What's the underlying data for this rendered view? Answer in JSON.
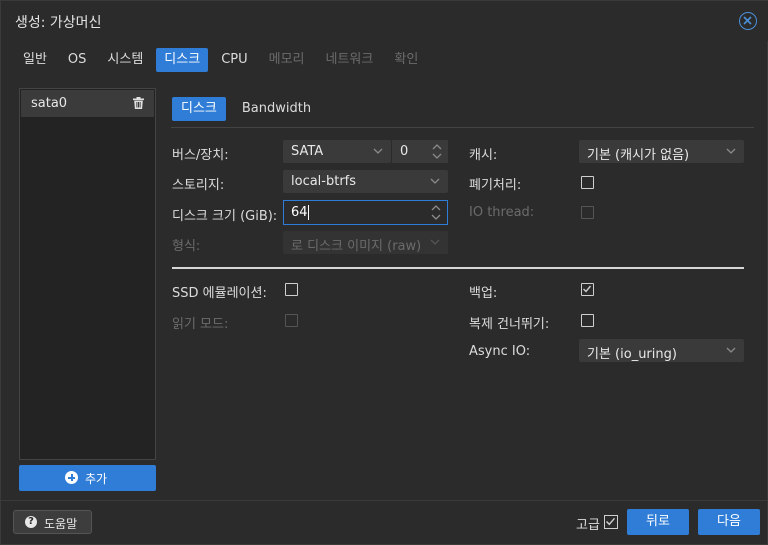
{
  "window": {
    "title": "생성: 가상머신"
  },
  "tabs": [
    {
      "label": "일반",
      "state": "normal"
    },
    {
      "label": "OS",
      "state": "normal"
    },
    {
      "label": "시스템",
      "state": "normal"
    },
    {
      "label": "디스크",
      "state": "active"
    },
    {
      "label": "CPU",
      "state": "normal"
    },
    {
      "label": "메모리",
      "state": "disabled"
    },
    {
      "label": "네트워크",
      "state": "disabled"
    },
    {
      "label": "확인",
      "state": "disabled"
    }
  ],
  "disk_list": {
    "items": [
      {
        "label": "sata0"
      }
    ],
    "add_label": "추가"
  },
  "subtabs": [
    {
      "label": "디스크",
      "active": true
    },
    {
      "label": "Bandwidth",
      "active": false
    }
  ],
  "form": {
    "bus": {
      "label": "버스/장치:",
      "value": "SATA",
      "device": "0"
    },
    "storage": {
      "label": "스토리지:",
      "value": "local-btrfs"
    },
    "disk_size": {
      "label": "디스크 크기 (GiB):",
      "value": "64"
    },
    "format": {
      "label": "형식:",
      "value": "로 디스크 이미지 (raw)"
    },
    "cache": {
      "label": "캐시:",
      "value": "기본 (캐시가 없음)"
    },
    "discard": {
      "label": "폐기처리:",
      "checked": false
    },
    "io_thread": {
      "label": "IO thread:",
      "checked": false
    },
    "ssd_emulation": {
      "label": "SSD 에뮬레이션:",
      "checked": false
    },
    "read_only": {
      "label": "읽기 모드:",
      "checked": false
    },
    "backup": {
      "label": "백업:",
      "checked": true
    },
    "skip_replication": {
      "label": "복제 건너뛰기:",
      "checked": false
    },
    "async_io": {
      "label": "Async IO:",
      "value": "기본 (io_uring)"
    }
  },
  "footer": {
    "help_label": "도움말",
    "advanced_label": "고급",
    "advanced_checked": true,
    "back_label": "뒤로",
    "next_label": "다음"
  },
  "colors": {
    "accent": "#2f7dd6",
    "background": "#2b2b2b",
    "field": "#3a3a3a"
  }
}
